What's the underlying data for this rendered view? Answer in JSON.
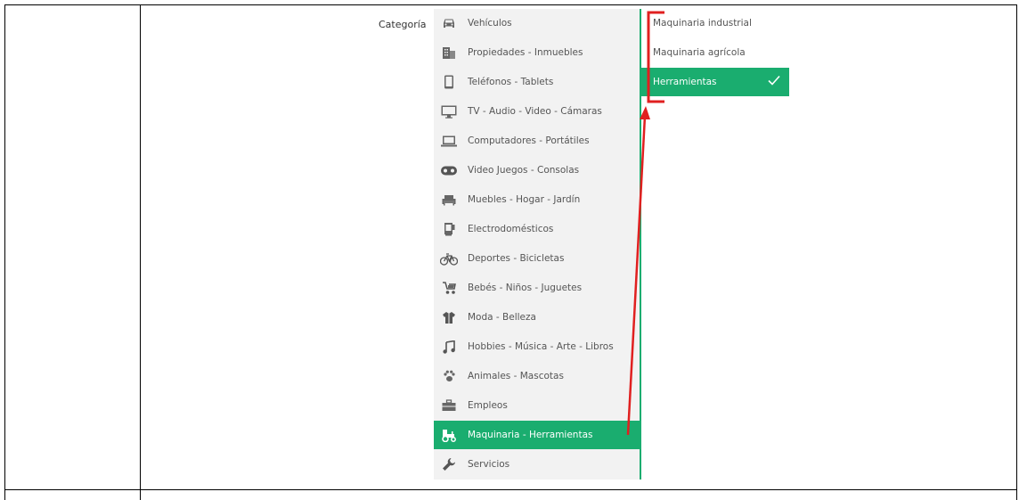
{
  "form": {
    "category_label": "Categoría"
  },
  "categories": [
    {
      "label": "Vehículos",
      "icon": "car-icon"
    },
    {
      "label": "Propiedades - Inmuebles",
      "icon": "building-icon"
    },
    {
      "label": "Teléfonos - Tablets",
      "icon": "phone-icon"
    },
    {
      "label": "TV - Audio - Video - Cámaras",
      "icon": "monitor-icon"
    },
    {
      "label": "Computadores - Portátiles",
      "icon": "laptop-icon"
    },
    {
      "label": "Video Juegos - Consolas",
      "icon": "gamepad-icon"
    },
    {
      "label": "Muebles - Hogar - Jardín",
      "icon": "sofa-icon"
    },
    {
      "label": "Electrodomésticos",
      "icon": "appliance-icon"
    },
    {
      "label": "Deportes - Bicicletas",
      "icon": "bicycle-icon"
    },
    {
      "label": "Bebés - Niños - Juguetes",
      "icon": "stroller-icon"
    },
    {
      "label": "Moda - Belleza",
      "icon": "clothing-icon"
    },
    {
      "label": "Hobbies - Música - Arte - Libros",
      "icon": "music-icon"
    },
    {
      "label": "Animales - Mascotas",
      "icon": "paw-icon"
    },
    {
      "label": "Empleos",
      "icon": "briefcase-icon"
    },
    {
      "label": "Maquinaria - Herramientas",
      "icon": "tractor-icon",
      "selected": true
    },
    {
      "label": "Servicios",
      "icon": "wrench-icon"
    }
  ],
  "subcategories": [
    {
      "label": "Maquinaria industrial"
    },
    {
      "label": "Maquinaria agrícola"
    },
    {
      "label": "Herramientas",
      "selected": true
    }
  ],
  "colors": {
    "accent": "#1aad6f",
    "annotation": "#e02020",
    "panel_bg": "#f2f2f2"
  }
}
